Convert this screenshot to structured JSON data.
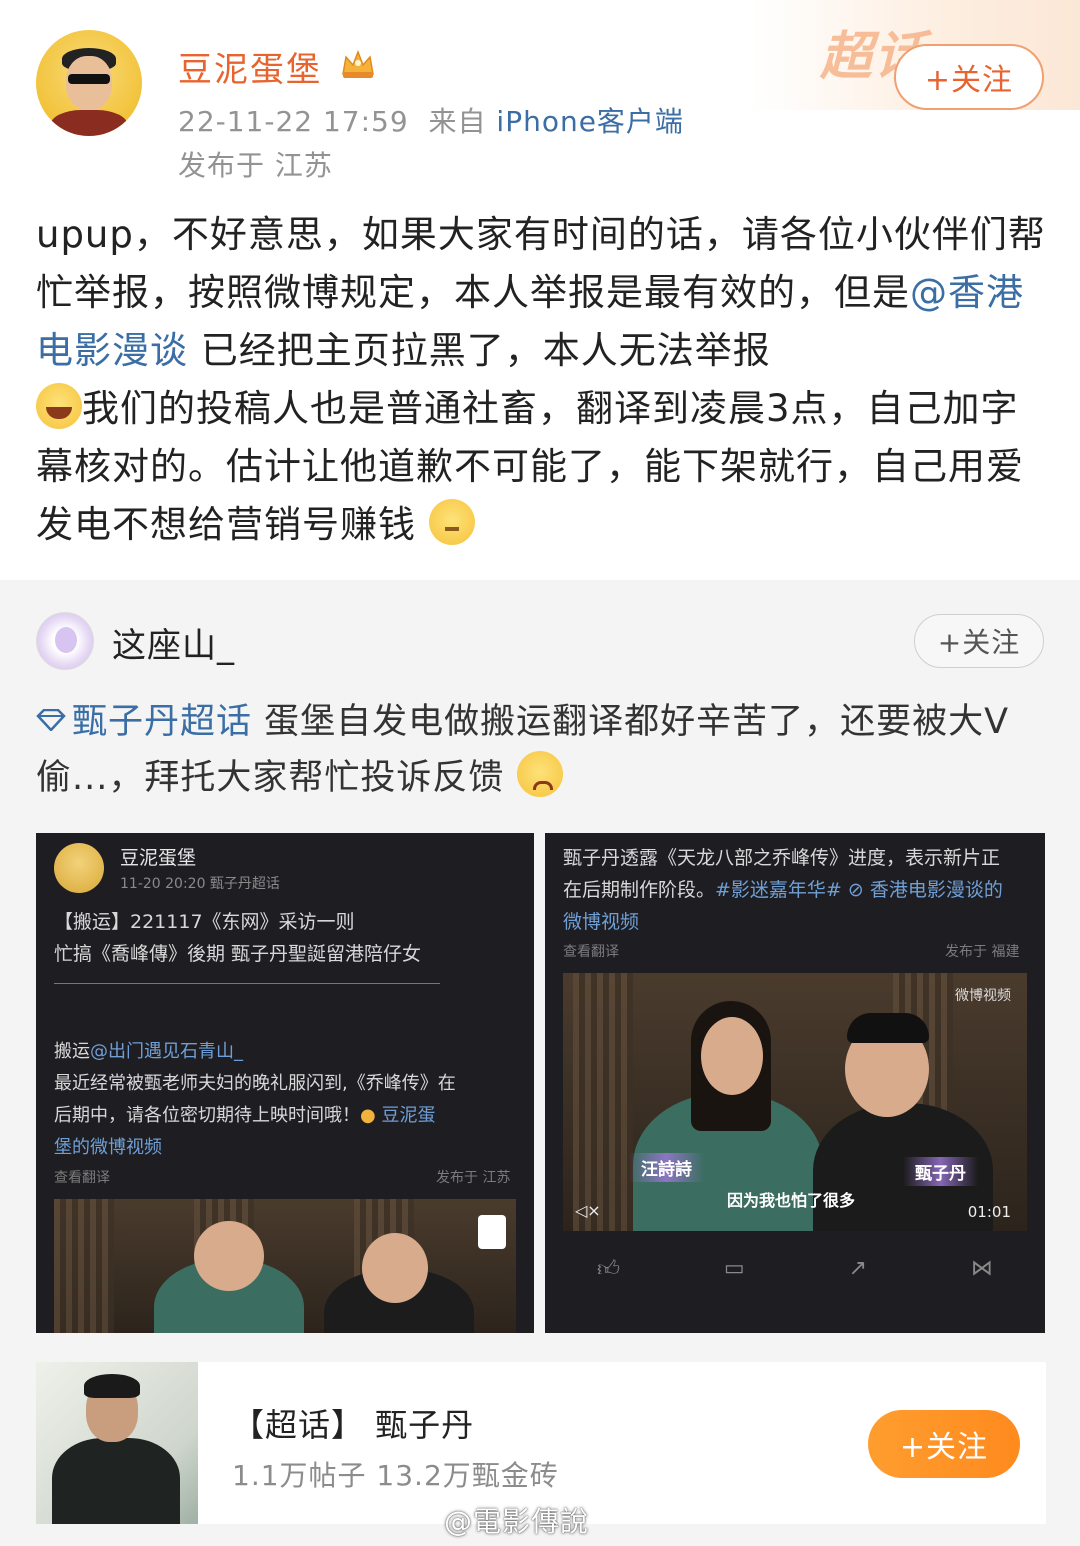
{
  "post": {
    "username": "豆泥蛋堡",
    "time": "22-11-22 17:59",
    "from_prefix": "来自",
    "source": "iPhone客户端",
    "location": "发布于 江苏",
    "follow_label": "+关注",
    "header_decoration": "超话",
    "text_part1": "upup，不好意思，如果大家有时间的话，请各位小伙伴们帮忙举报，按照微博规定，本人举报是最有效的，但是",
    "mention": "@香港电影漫谈",
    "text_part2": " 已经把主页拉黑了，本人无法举报",
    "text_part3": "我们的投稿人也是普通社畜，翻译到凌晨3点，自己加字幕核对的。估计让他道歉不可能了，能下架就行，自己用爱发电不想给营销号赚钱",
    "emoji_1": "laugh-emoji",
    "emoji_2": "think-emoji"
  },
  "repost": {
    "username": "这座山_",
    "follow_label": "+关注",
    "topic": "甄子丹超话",
    "text": " 蛋堡自发电做搬运翻译都好辛苦了，还要被大V偷...，拜托大家帮忙投诉反馈",
    "emoji": "sad-emoji"
  },
  "shot_left": {
    "username": "豆泥蛋堡",
    "meta": "11-20 20:20  甄子丹超话",
    "line1": "【搬运】221117《东网》采访一则",
    "line2": "忙搞《喬峰傳》後期    甄子丹聖誕留港陪仔女",
    "repost_prefix": "搬运",
    "repost_user": "@出门遇见石青山_",
    "line3": "最近经常被甄老师夫妇的晚礼服闪到,《乔峰传》在",
    "line4_prefix": "后期中，请各位密切期待上映时间哦！",
    "line4_link": "豆泥蛋",
    "line5_link": "堡的微博视频",
    "translate": "查看翻译",
    "location": "发布于 江苏"
  },
  "shot_right": {
    "line1": "甄子丹透露《天龙八部之乔峰传》进度，表示新片正",
    "line2_prefix": "在后期制作阶段。",
    "line2_tag": "#影迷嘉年华#",
    "line2_link": "香港电影漫谈的",
    "line3_link": "微博视频",
    "translate": "查看翻译",
    "location": "发布于 福建",
    "name_left": "汪詩詩",
    "name_right": "甄子丹",
    "subtitle": "因为我也怕了很多",
    "duration": "01:01",
    "video_logo": "微博视频"
  },
  "topic_card": {
    "title": "【超话】 甄子丹",
    "stats": "1.1万帖子 13.2万甄金砖",
    "follow_label": "+关注"
  },
  "watermark": "@電影傳說",
  "colors": {
    "username_orange": "#e8632e",
    "link_blue": "#3a6ea5",
    "follow_orange": "#ff8a1e",
    "gray_text": "#939393"
  }
}
